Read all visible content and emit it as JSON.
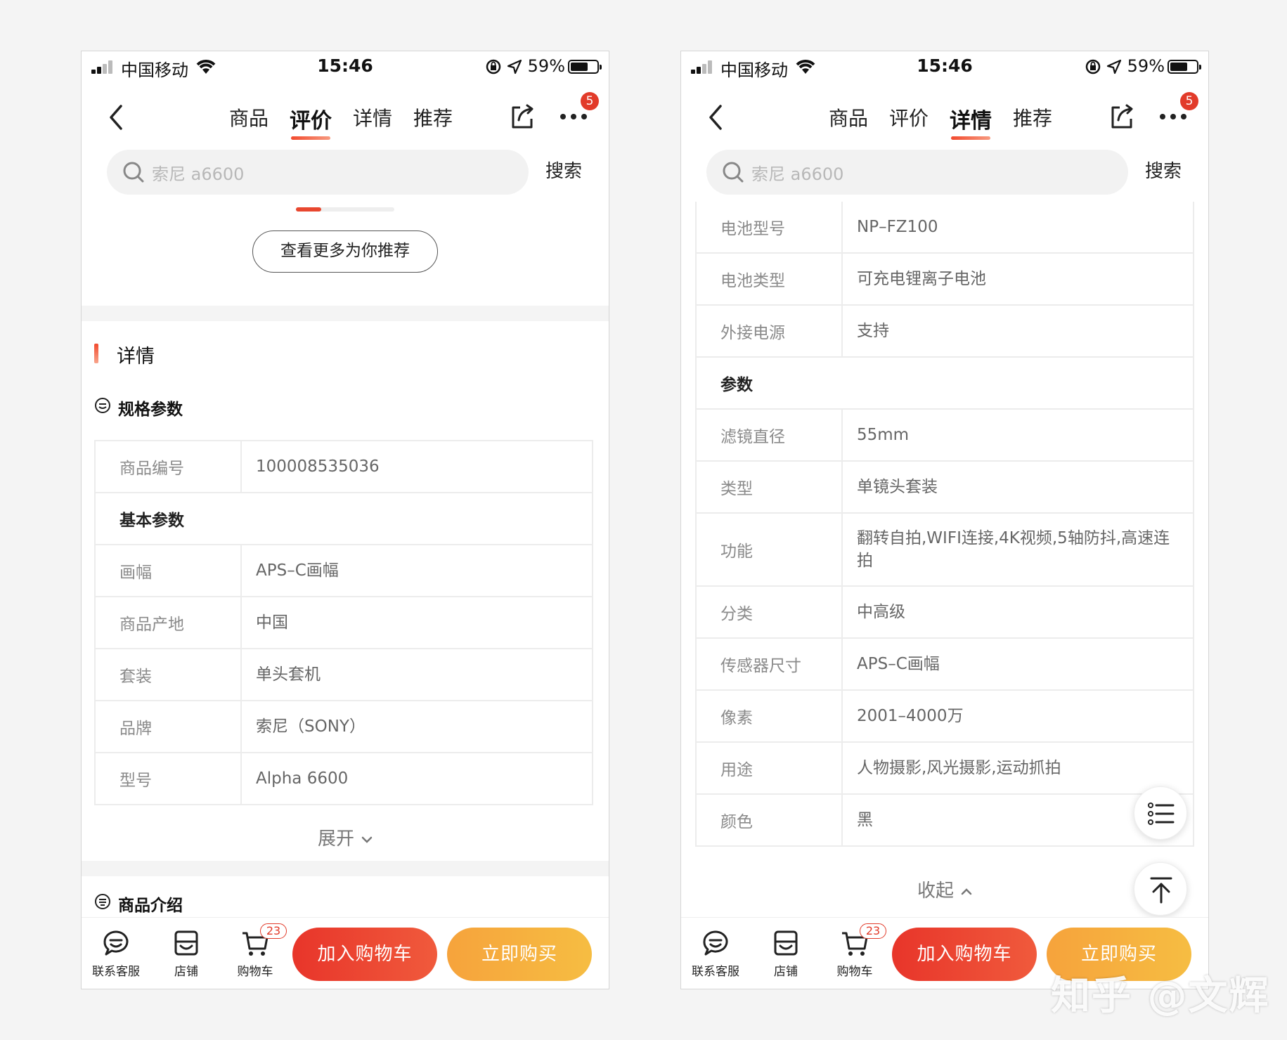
{
  "status": {
    "carrier": "中国移动",
    "time": "15:46",
    "battery": "59%",
    "battery_level": 0.59
  },
  "nav": {
    "tabs": [
      "商品",
      "评价",
      "详情",
      "推荐"
    ],
    "more_badge": "5"
  },
  "search": {
    "placeholder": "索尼 a6600",
    "button": "搜索"
  },
  "left": {
    "active_tab": 1,
    "more_rec": "查看更多为你推荐",
    "section_title": "详情",
    "spec_title": "规格参数",
    "specs": [
      {
        "k": "商品编号",
        "v": "100008535036"
      },
      {
        "k": "基本参数",
        "group": true
      },
      {
        "k": "画幅",
        "v": "APS–C画幅"
      },
      {
        "k": "商品产地",
        "v": "中国"
      },
      {
        "k": "套装",
        "v": "单头套机"
      },
      {
        "k": "品牌",
        "v": "索尼（SONY）"
      },
      {
        "k": "型号",
        "v": "Alpha 6600"
      }
    ],
    "expand": "展开",
    "intro_title": "商品介绍"
  },
  "right": {
    "active_tab": 2,
    "specs": [
      {
        "k": "电池型号",
        "v": "NP–FZ100"
      },
      {
        "k": "电池类型",
        "v": "可充电锂离子电池"
      },
      {
        "k": "外接电源",
        "v": "支持"
      },
      {
        "k": "参数",
        "group": true
      },
      {
        "k": "滤镜直径",
        "v": "55mm"
      },
      {
        "k": "类型",
        "v": "单镜头套装"
      },
      {
        "k": "功能",
        "v": "翻转自拍,WIFI连接,4K视频,5轴防抖,高速连拍",
        "tall": true
      },
      {
        "k": "分类",
        "v": "中高级"
      },
      {
        "k": "传感器尺寸",
        "v": "APS–C画幅"
      },
      {
        "k": "像素",
        "v": "2001–4000万"
      },
      {
        "k": "用途",
        "v": "人物摄影,风光摄影,运动抓拍"
      },
      {
        "k": "颜色",
        "v": "黑"
      }
    ],
    "collapse": "收起"
  },
  "bottom": {
    "service": "联系客服",
    "shop": "店铺",
    "cart": "购物车",
    "cart_badge": "23",
    "add_to_cart": "加入购物车",
    "buy_now": "立即购买"
  },
  "watermark": "知乎 @文辉"
}
